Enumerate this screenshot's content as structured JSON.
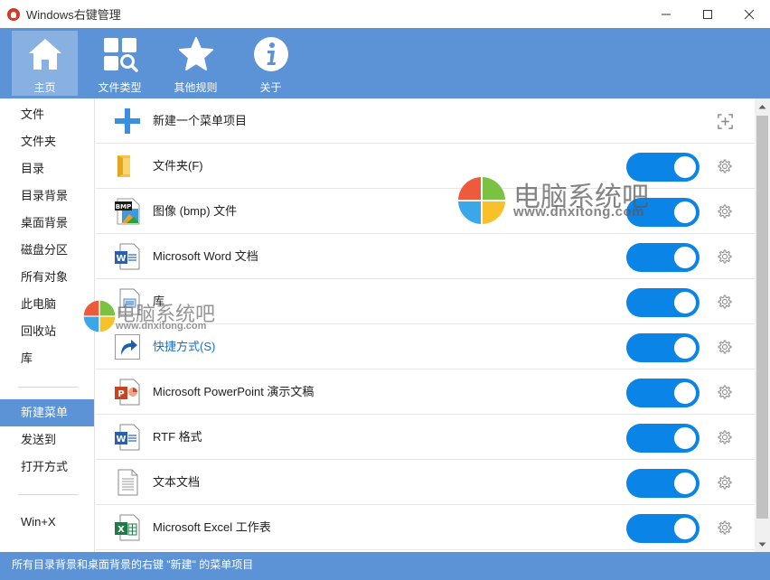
{
  "window": {
    "title": "Windows右键管理",
    "icon": "app-penguin-icon"
  },
  "toolbar": {
    "items": [
      {
        "label": "主页",
        "icon": "home-icon",
        "active": true
      },
      {
        "label": "文件类型",
        "icon": "file-types-icon",
        "active": false
      },
      {
        "label": "其他规则",
        "icon": "star-icon",
        "active": false
      },
      {
        "label": "关于",
        "icon": "info-icon",
        "active": false
      }
    ]
  },
  "sidebar": {
    "items": [
      {
        "label": "文件"
      },
      {
        "label": "文件夹"
      },
      {
        "label": "目录"
      },
      {
        "label": "目录背景"
      },
      {
        "label": "桌面背景"
      },
      {
        "label": "磁盘分区"
      },
      {
        "label": "所有对象"
      },
      {
        "label": "此电脑"
      },
      {
        "label": "回收站"
      },
      {
        "label": "库"
      },
      {
        "label": "新建菜单",
        "selected": true
      },
      {
        "label": "发送到"
      },
      {
        "label": "打开方式"
      },
      {
        "label": "Win+X"
      }
    ]
  },
  "list": {
    "new_item": {
      "label": "新建一个菜单项目",
      "icon": "plus-icon",
      "action_icon": "add-circle-icon"
    },
    "items": [
      {
        "label": "文件夹(F)",
        "icon": "folder-icon",
        "enabled": true
      },
      {
        "label": "图像 (bmp) 文件",
        "icon": "bmp-file-icon",
        "enabled": true
      },
      {
        "label": "Microsoft Word 文档",
        "icon": "word-doc-icon",
        "enabled": true
      },
      {
        "label": "库",
        "icon": "library-icon",
        "enabled": true
      },
      {
        "label": "快捷方式(S)",
        "icon": "shortcut-icon",
        "enabled": true,
        "link": true
      },
      {
        "label": "Microsoft PowerPoint 演示文稿",
        "icon": "powerpoint-icon",
        "enabled": true
      },
      {
        "label": "RTF 格式",
        "icon": "rtf-doc-icon",
        "enabled": true
      },
      {
        "label": "文本文档",
        "icon": "text-doc-icon",
        "enabled": true
      },
      {
        "label": "Microsoft Excel 工作表",
        "icon": "excel-icon",
        "enabled": true
      }
    ]
  },
  "statusbar": {
    "text": "所有目录背景和桌面背景的右键 \"新建\" 的菜单项目"
  },
  "watermark": {
    "text": "电脑系统吧",
    "url": "www.dnxitong.com"
  },
  "colors": {
    "accent": "#5b93d6",
    "toggle_on": "#0a84e6"
  }
}
